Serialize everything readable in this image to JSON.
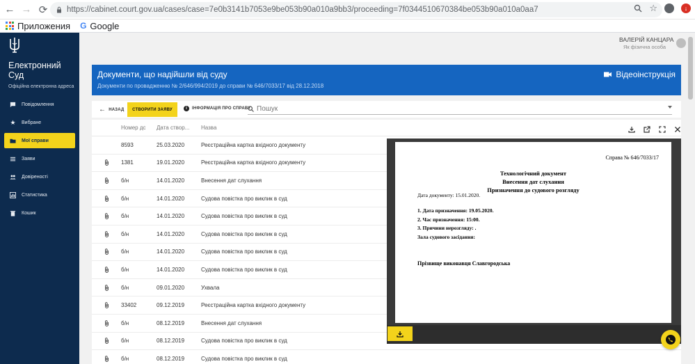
{
  "browser": {
    "url": "https://cabinet.court.gov.ua/cases/case=7e0b3141b7053e9be053b90a010a9bb3/proceeding=7f0344510670384be053b90a010a0aa7",
    "bookmarks": [
      {
        "label": "Приложения"
      },
      {
        "label": "Google"
      }
    ]
  },
  "sidebar": {
    "brand_line1": "Електронний",
    "brand_line2": "Суд",
    "brand_sub": "Офіційна електронна адреса",
    "items": [
      {
        "label": "Повідомлення",
        "icon": "message-icon"
      },
      {
        "label": "Вибране",
        "icon": "star-icon"
      },
      {
        "label": "Мої справи",
        "icon": "folder-icon",
        "active": true
      },
      {
        "label": "Заяви",
        "icon": "list-icon"
      },
      {
        "label": "Довіреності",
        "icon": "people-icon"
      },
      {
        "label": "Статистика",
        "icon": "chart-icon"
      },
      {
        "label": "Кошик",
        "icon": "trash-icon"
      }
    ]
  },
  "user": {
    "name": "ВАЛЕРІЙ КАНЦАРА",
    "role": "Як фізична особа"
  },
  "banner": {
    "title": "Документи, що надійшли від суду",
    "subtitle": "Документи по провадженню № 2/646/994/2019 до справи № 646/7033/17 від 28.12.2018",
    "video_label": "Відеоінструкція"
  },
  "toolbar": {
    "back_label": "НАЗАД",
    "create_label": "СТВОРИТИ ЗАЯВУ",
    "info_label": "ІНФОРМАЦІЯ ПРО СПРАВУ",
    "search_placeholder": "Пошук"
  },
  "table": {
    "headers": {
      "num": "Номер док...",
      "date": "Дата створ...",
      "name": "Назва"
    },
    "rows": [
      {
        "attach": false,
        "num": "8593",
        "date": "25.03.2020",
        "name": "Реєстраційна картка вхідного документу"
      },
      {
        "attach": true,
        "num": "1381",
        "date": "19.01.2020",
        "name": "Реєстраційна картка вхідного документу"
      },
      {
        "attach": true,
        "num": "б/н",
        "date": "14.01.2020",
        "name": "Внесення дат слухання"
      },
      {
        "attach": true,
        "num": "б/н",
        "date": "14.01.2020",
        "name": "Судова повістка про виклик в суд"
      },
      {
        "attach": true,
        "num": "б/н",
        "date": "14.01.2020",
        "name": "Судова повістка про виклик в суд"
      },
      {
        "attach": true,
        "num": "б/н",
        "date": "14.01.2020",
        "name": "Судова повістка про виклик в суд"
      },
      {
        "attach": true,
        "num": "б/н",
        "date": "14.01.2020",
        "name": "Судова повістка про виклик в суд"
      },
      {
        "attach": true,
        "num": "б/н",
        "date": "14.01.2020",
        "name": "Судова повістка про виклик в суд"
      },
      {
        "attach": true,
        "num": "б/н",
        "date": "09.01.2020",
        "name": "Ухвала"
      },
      {
        "attach": true,
        "num": "33402",
        "date": "09.12.2019",
        "name": "Реєстраційна картка вхідного документу"
      },
      {
        "attach": true,
        "num": "б/н",
        "date": "08.12.2019",
        "name": "Внесення дат слухання"
      },
      {
        "attach": true,
        "num": "б/н",
        "date": "08.12.2019",
        "name": "Судова повістка про виклик в суд"
      },
      {
        "attach": true,
        "num": "б/н",
        "date": "08.12.2019",
        "name": "Судова повістка про виклик в суд"
      }
    ]
  },
  "preview": {
    "case": "Справа № 646/7033/17",
    "title1": "Технологічний документ",
    "title2": "Внесення дат слухання",
    "title3": "Призначення до судового розгляду",
    "date_line": "Дата документу: 15.01.2020.",
    "line1": "1. Дата призначення: 19.05.2020.",
    "line2": "2. Час призначення: 15:00.",
    "line3": "3. Причини нерозгляду: .",
    "line4": "Зала судового засідання:",
    "executor": "Прізвище виконавця Славгородська"
  },
  "colors": {
    "sidebar_bg": "#0d2b4e",
    "accent_yellow": "#f3d31b",
    "banner_blue": "#1565c0"
  }
}
